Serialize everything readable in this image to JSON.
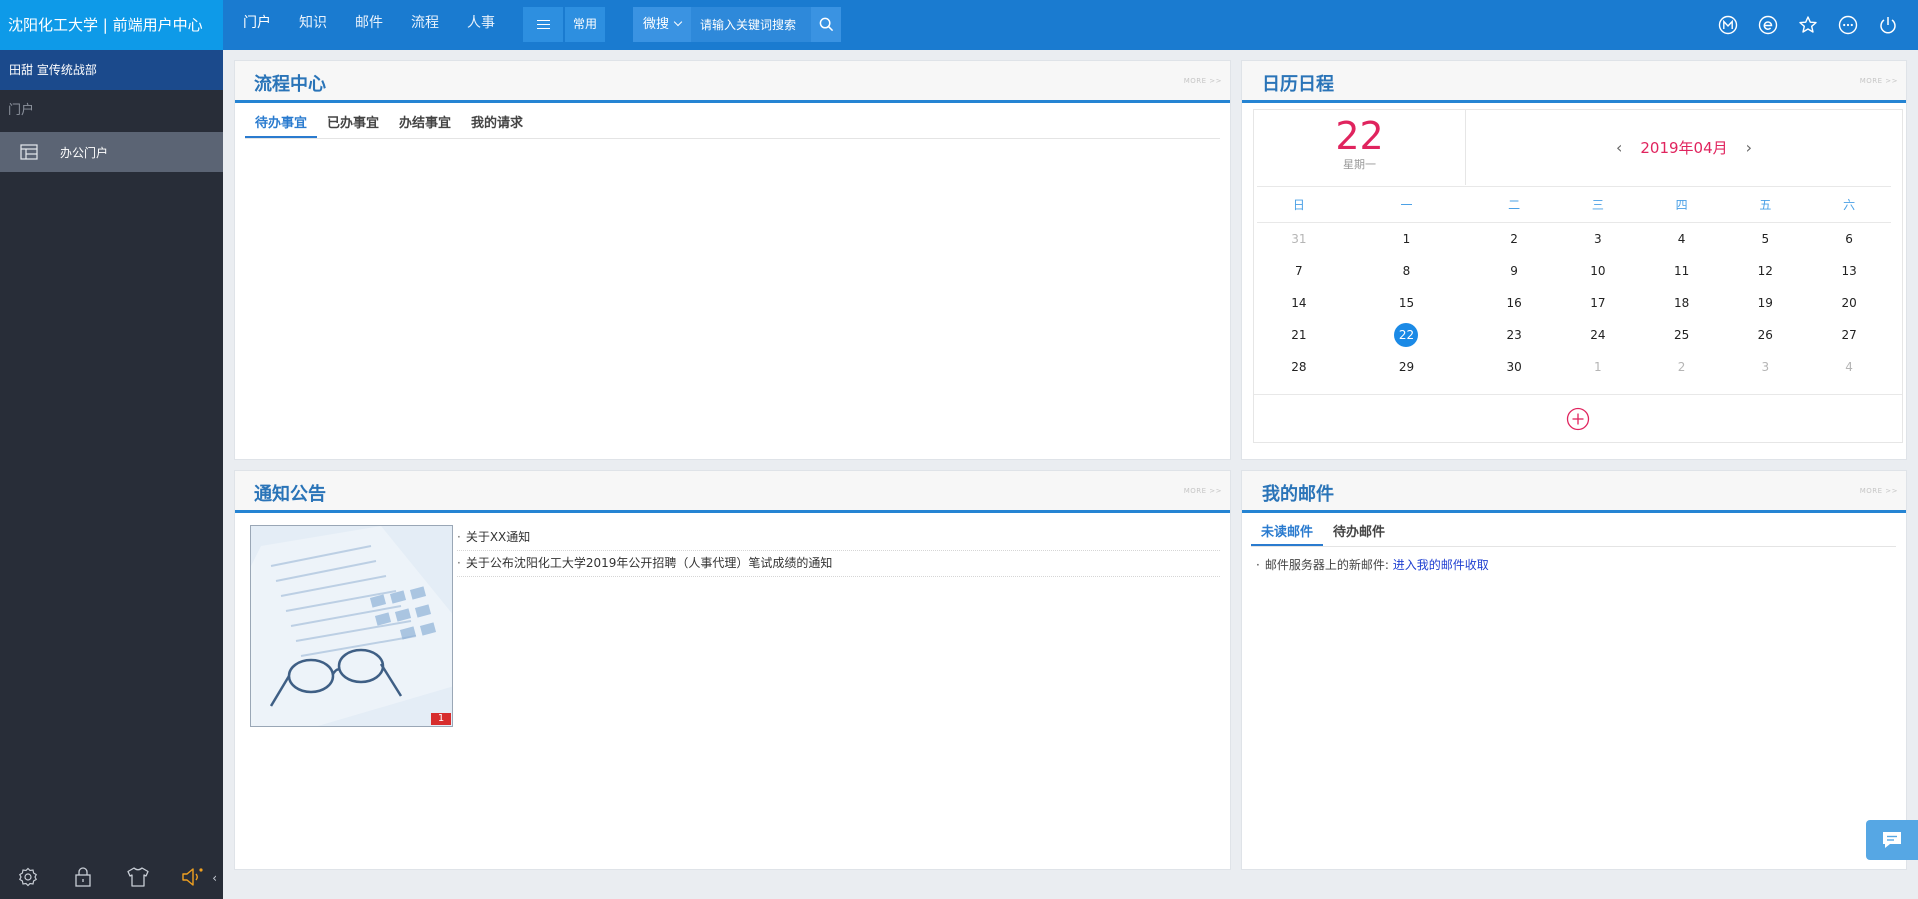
{
  "brand": {
    "title": "沈阳化工大学 | 前端用户中心"
  },
  "topnav": {
    "items": [
      "门户",
      "知识",
      "邮件",
      "流程",
      "人事"
    ],
    "common_label": "常用"
  },
  "search": {
    "scope": "微搜",
    "placeholder": "请输入关键词搜索"
  },
  "top_icons": [
    "m-circle-icon",
    "e-circle-icon",
    "star-icon",
    "more-circle-icon",
    "power-icon"
  ],
  "sidebar": {
    "user": "田甜 宣传统战部",
    "section": "门户",
    "items": [
      {
        "label": "办公门户",
        "icon": "layout-icon"
      }
    ],
    "footer_icons": [
      "settings-icon",
      "lock-icon",
      "shirt-icon",
      "speaker-icon"
    ],
    "collapse": "‹"
  },
  "workflow": {
    "title": "流程中心",
    "more": "MORE >>",
    "tabs": [
      "待办事宜",
      "已办事宜",
      "办结事宜",
      "我的请求"
    ]
  },
  "calendar": {
    "title": "日历日程",
    "more": "MORE >>",
    "today_day": "22",
    "today_week": "星期一",
    "month_label": "2019年04月",
    "prev": "‹",
    "next": "›",
    "weekdays": [
      "日",
      "一",
      "二",
      "三",
      "四",
      "五",
      "六"
    ],
    "weeks": [
      [
        {
          "d": "31",
          "o": true
        },
        {
          "d": "1"
        },
        {
          "d": "2"
        },
        {
          "d": "3"
        },
        {
          "d": "4"
        },
        {
          "d": "5"
        },
        {
          "d": "6"
        }
      ],
      [
        {
          "d": "7"
        },
        {
          "d": "8"
        },
        {
          "d": "9"
        },
        {
          "d": "10"
        },
        {
          "d": "11"
        },
        {
          "d": "12"
        },
        {
          "d": "13"
        }
      ],
      [
        {
          "d": "14"
        },
        {
          "d": "15"
        },
        {
          "d": "16"
        },
        {
          "d": "17"
        },
        {
          "d": "18"
        },
        {
          "d": "19"
        },
        {
          "d": "20"
        }
      ],
      [
        {
          "d": "21"
        },
        {
          "d": "22",
          "t": true
        },
        {
          "d": "23"
        },
        {
          "d": "24"
        },
        {
          "d": "25"
        },
        {
          "d": "26"
        },
        {
          "d": "27"
        }
      ],
      [
        {
          "d": "28"
        },
        {
          "d": "29"
        },
        {
          "d": "30"
        },
        {
          "d": "1",
          "o": true
        },
        {
          "d": "2",
          "o": true
        },
        {
          "d": "3",
          "o": true
        },
        {
          "d": "4",
          "o": true
        }
      ]
    ]
  },
  "notice": {
    "title": "通知公告",
    "more": "MORE >>",
    "image_badge": "1",
    "items": [
      "关于XX通知",
      "关于公布沈阳化工大学2019年公开招聘（人事代理）笔试成绩的通知"
    ]
  },
  "mail": {
    "title": "我的邮件",
    "more": "MORE >>",
    "tabs": [
      "未读邮件",
      "待办邮件"
    ],
    "line_prefix": "邮件服务器上的新邮件:",
    "line_link": "进入我的邮件收取"
  },
  "colors": {
    "primary": "#1a7bd0",
    "brand_bg": "#0e9ae8",
    "sidebar": "#282d38",
    "accent_red": "#e0245e",
    "title_blue": "#2a74b8"
  }
}
